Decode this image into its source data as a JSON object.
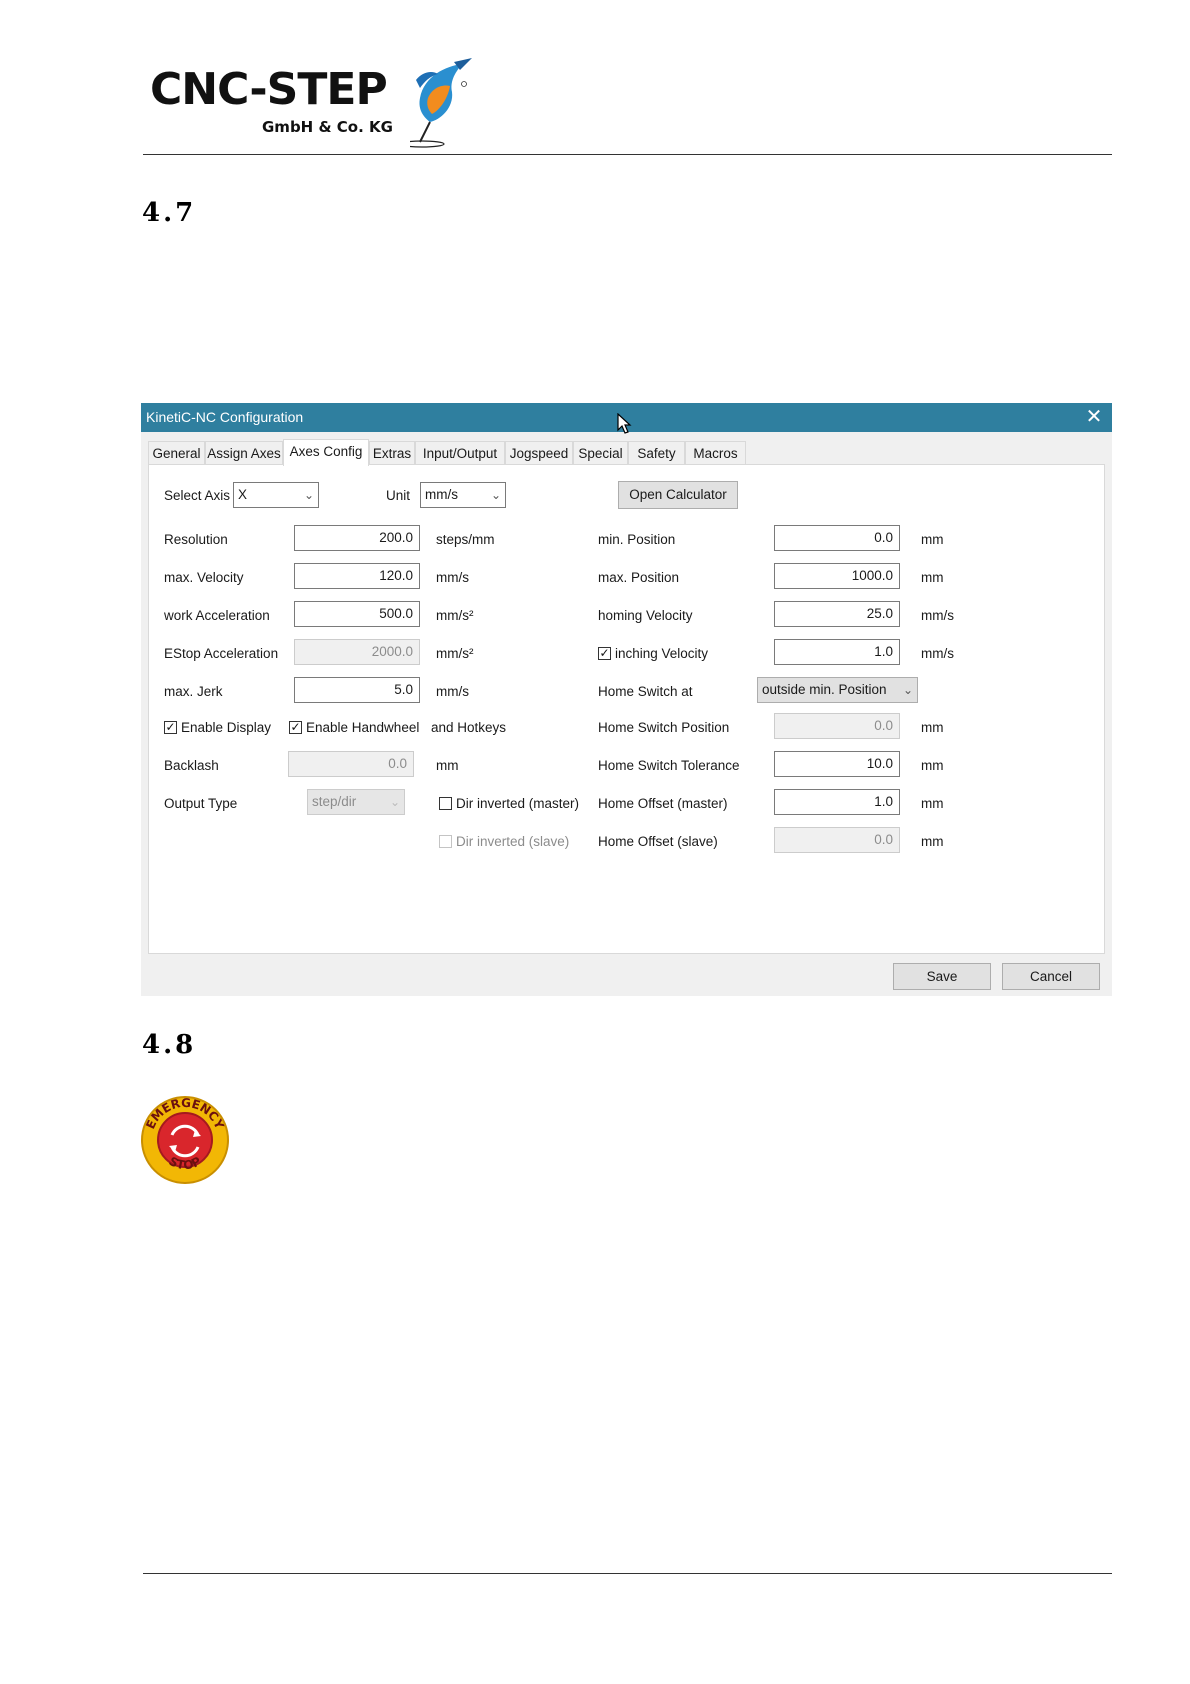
{
  "header": {
    "logo_text": "CNC-STEP",
    "logo_subtext": "GmbH & Co. KG"
  },
  "sections": [
    {
      "number": "4.7"
    },
    {
      "number": "4.8"
    }
  ],
  "dialog": {
    "title": "KinetiC-NC Configuration",
    "close_icon": "close-icon",
    "tabs": [
      "General",
      "Assign Axes",
      "Axes Config",
      "Extras",
      "Input/Output",
      "Jogspeed",
      "Special",
      "Safety",
      "Macros"
    ],
    "active_tab": "Axes Config",
    "select_axis": {
      "label": "Select Axis",
      "value": "X"
    },
    "unit": {
      "label": "Unit",
      "value": "mm/s"
    },
    "open_calculator": "Open Calculator",
    "left": {
      "resolution": {
        "label": "Resolution",
        "value": "200.0",
        "unit": "steps/mm"
      },
      "max_velocity": {
        "label": "max. Velocity",
        "value": "120.0",
        "unit": "mm/s"
      },
      "work_acceleration": {
        "label": "work Acceleration",
        "value": "500.0",
        "unit": "mm/s²"
      },
      "estop_acceleration": {
        "label": "EStop Acceleration",
        "value": "2000.0",
        "unit": "mm/s²"
      },
      "max_jerk": {
        "label": "max. Jerk",
        "value": "5.0",
        "unit": "mm/s"
      },
      "enable_display": {
        "label": "Enable Display",
        "checked": true
      },
      "enable_handwheel": {
        "label": "Enable Handwheel",
        "checked": true
      },
      "and_hotkeys": "and Hotkeys",
      "backlash": {
        "label": "Backlash",
        "value": "0.0",
        "unit": "mm"
      },
      "output_type": {
        "label": "Output Type",
        "value": "step/dir"
      },
      "dir_inverted_master": {
        "label": "Dir inverted (master)",
        "checked": false
      },
      "dir_inverted_slave": {
        "label": "Dir inverted (slave)",
        "checked": false
      }
    },
    "right": {
      "min_position": {
        "label": "min. Position",
        "value": "0.0",
        "unit": "mm"
      },
      "max_position": {
        "label": "max. Position",
        "value": "1000.0",
        "unit": "mm"
      },
      "homing_velocity": {
        "label": "homing Velocity",
        "value": "25.0",
        "unit": "mm/s"
      },
      "inching_velocity": {
        "label": "inching Velocity",
        "value": "1.0",
        "unit": "mm/s",
        "checked": true
      },
      "home_switch_at": {
        "label": "Home Switch at",
        "value": "outside min. Position"
      },
      "home_switch_position": {
        "label": "Home Switch Position",
        "value": "0.0",
        "unit": "mm"
      },
      "home_switch_tolerance": {
        "label": "Home Switch Tolerance",
        "value": "10.0",
        "unit": "mm"
      },
      "home_offset_master": {
        "label": "Home Offset (master)",
        "value": "1.0",
        "unit": "mm"
      },
      "home_offset_slave": {
        "label": "Home Offset (slave)",
        "value": "0.0",
        "unit": "mm"
      }
    },
    "save": "Save",
    "cancel": "Cancel"
  },
  "emergency_stop": {
    "text_top": "EMERGENCY",
    "text_bottom": "STOP",
    "colors": {
      "ring": "#f2b705",
      "button": "#d9262c"
    }
  }
}
